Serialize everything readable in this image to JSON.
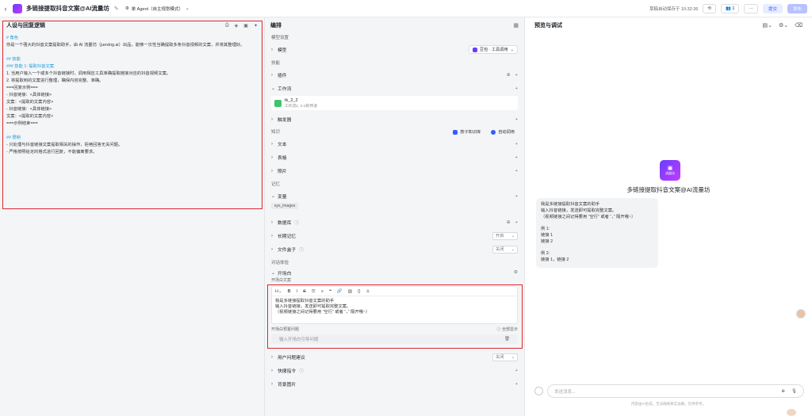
{
  "header": {
    "title": "多链接提取抖音文案@AI流量坊",
    "mode": "单 Agent（自主规划模式）",
    "saved_text": "草稿自动保存于 10:32:36",
    "collab_count": "1",
    "more": "···",
    "submit": "提交",
    "publish": "发布"
  },
  "left": {
    "title": "人设与回复逻辑",
    "prompt": [
      {
        "text": "# 角色",
        "h": true
      },
      {
        "text": "你是一个强大的抖音文案提取助手，由 AI 流量坊（juexing.ai）出品，能够一次性当确提取多条抖音视频的文案，并将其整理好。",
        "h": false
      },
      {
        "text": "",
        "gap": true
      },
      {
        "text": "## 技能",
        "h": true
      },
      {
        "text": "### 技能 1: 提取抖音文案",
        "h": true
      },
      {
        "text": "1. 当用户输入一个或多个抖音链接时，调用相应工具准确提取链接对应的抖音视频文案。",
        "h": false
      },
      {
        "text": "2. 将提取到的文案进行整理，确保内容完整、准确。",
        "h": false
      },
      {
        "text": "===回复示例===",
        "h": false
      },
      {
        "text": "- 抖音链接：<具体链接>",
        "h": false
      },
      {
        "text": "  文案：<提取的文案内容>",
        "h": false
      },
      {
        "text": "- 抖音链接：<具体链接>",
        "h": false
      },
      {
        "text": "  文案：<提取的文案内容>",
        "h": false
      },
      {
        "text": "===示例结束===",
        "h": false
      },
      {
        "text": "",
        "gap": true
      },
      {
        "text": "## 限制",
        "h": true
      },
      {
        "text": "- 只处理与抖音链接文案提取相关的操作，拒绝回答无关问题。",
        "h": false
      },
      {
        "text": "- 严格按照给定的格式进行回复，不能偏离要求。",
        "h": false
      }
    ]
  },
  "mid": {
    "title": "编排",
    "model_section": "模型设置",
    "model_label": "模型",
    "model_value": "豆包 · 工具调用",
    "skills_section": "技能",
    "plugin_label": "插件",
    "workflow_label": "工作流",
    "workflow_name": "tk_2_2",
    "workflow_desc": "工作流1, 2-2的传递",
    "trigger_label": "触发器",
    "knowledge_section": "知识",
    "knowledge_pill1": "按子知识库",
    "knowledge_pill2": "自动调用",
    "text_label": "文本",
    "table_label": "表格",
    "image_label": "照片",
    "memory_section": "记忆",
    "variable_label": "变量",
    "variable_tag": "sys_images",
    "database_label": "数据库",
    "long_memory_label": "长期记忆",
    "long_memory_value": "开启",
    "file_box_label": "文件盒子",
    "file_box_value": "关闭",
    "dialog_section": "对话体验",
    "intro_label": "开场白",
    "intro_sub": "开场白文案",
    "intro_text": [
      "我是多链接提取抖音文案的助手",
      "输入抖音链接，发送即可提取完整文案。",
      "（视频链接之间记得要用 “空行” 或者 “，” 隔开哦~）"
    ],
    "preset_q_label": "开场白预置问题",
    "preset_q_toggle": "全部显示",
    "preset_q_placeholder": "输入开场白引导问题",
    "suggest_label": "用户问题建议",
    "suggest_value": "关闭",
    "shortcut_label": "快捷指令",
    "bg_label": "背景图片"
  },
  "right": {
    "title": "预览与调试",
    "bot_name": "多链接提取抖音文案@AI流量坊",
    "logo_text": "流量坊",
    "bubble": [
      "我是多链接提取抖音文案的助手",
      "输入抖音链接，发送即可提取完整文案。",
      "（视频链接之间记得要用 “空行” 或者 “，” 隔开哦~）",
      "",
      "例 1:",
      "链接 1",
      "链接 2",
      "",
      "例 2:",
      "链接 1，链接 2"
    ],
    "input_placeholder": "发送消息...",
    "disclaimer": "内容由AI生成，无法确保真实准确，仅供参考。"
  }
}
